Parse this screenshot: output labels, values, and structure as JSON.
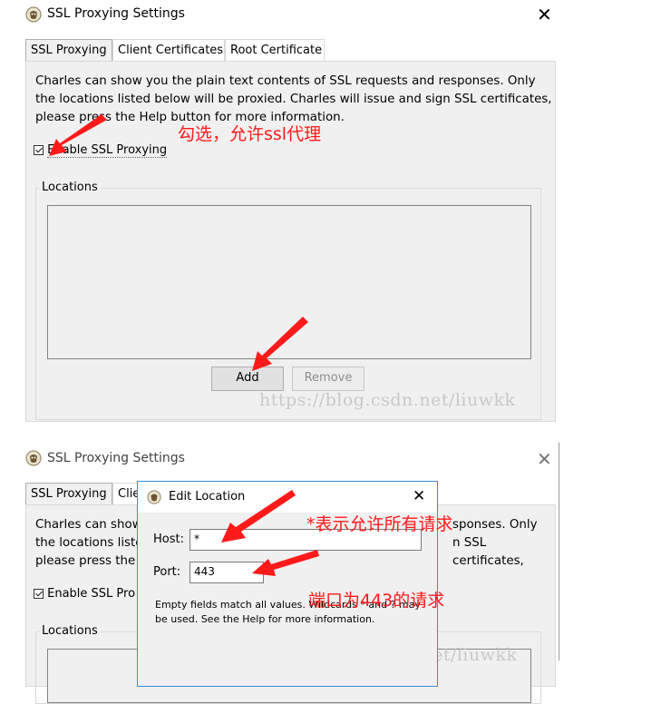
{
  "top": {
    "window_title": "SSL Proxying Settings",
    "tabs": [
      {
        "label": "SSL Proxying"
      },
      {
        "label": "Client Certificates"
      },
      {
        "label": "Root Certificate"
      }
    ],
    "description_lines": [
      "Charles can show you the plain text contents of SSL requests and responses. Only",
      "the locations listed below will be proxied. Charles will issue and sign SSL certificates,",
      "please press the Help button for more information."
    ],
    "enable_label": "Enable SSL Proxying",
    "enable_checked": true,
    "locations_label": "Locations",
    "add_label": "Add",
    "remove_label": "Remove",
    "annotation_enable": "勾选，允许ssl代理",
    "watermark": "https://blog.csdn.net/liuwkk"
  },
  "bottom": {
    "window_title": "SSL Proxying Settings",
    "tab_active": "SSL Proxying",
    "tab_partial": "Clie",
    "desc_fragments": {
      "l1_left": "Charles can show",
      "l2_left": "the locations liste",
      "l3_left": "please press the",
      "l1_right": "sponses. Only",
      "l2_right": "n SSL certificates,"
    },
    "enable_label": "Enable SSL Pro",
    "locations_label": "Locations",
    "watermark": "https://blog.csdn.net/liuwkk",
    "dialog": {
      "title": "Edit Location",
      "host_label": "Host:",
      "host_value": "*",
      "port_label": "Port:",
      "port_value": "443",
      "help_line1": "Empty fields match all values. Wildcards * and ? may",
      "help_line2": "be used. See the Help for more information."
    },
    "annotation_host": "*表示允许所有请求",
    "annotation_port": "端口为443的请求"
  },
  "colors": {
    "annotation": "#ff1a1a",
    "dialog_border": "#3f8ad3",
    "panel": "#f0f0f0"
  }
}
